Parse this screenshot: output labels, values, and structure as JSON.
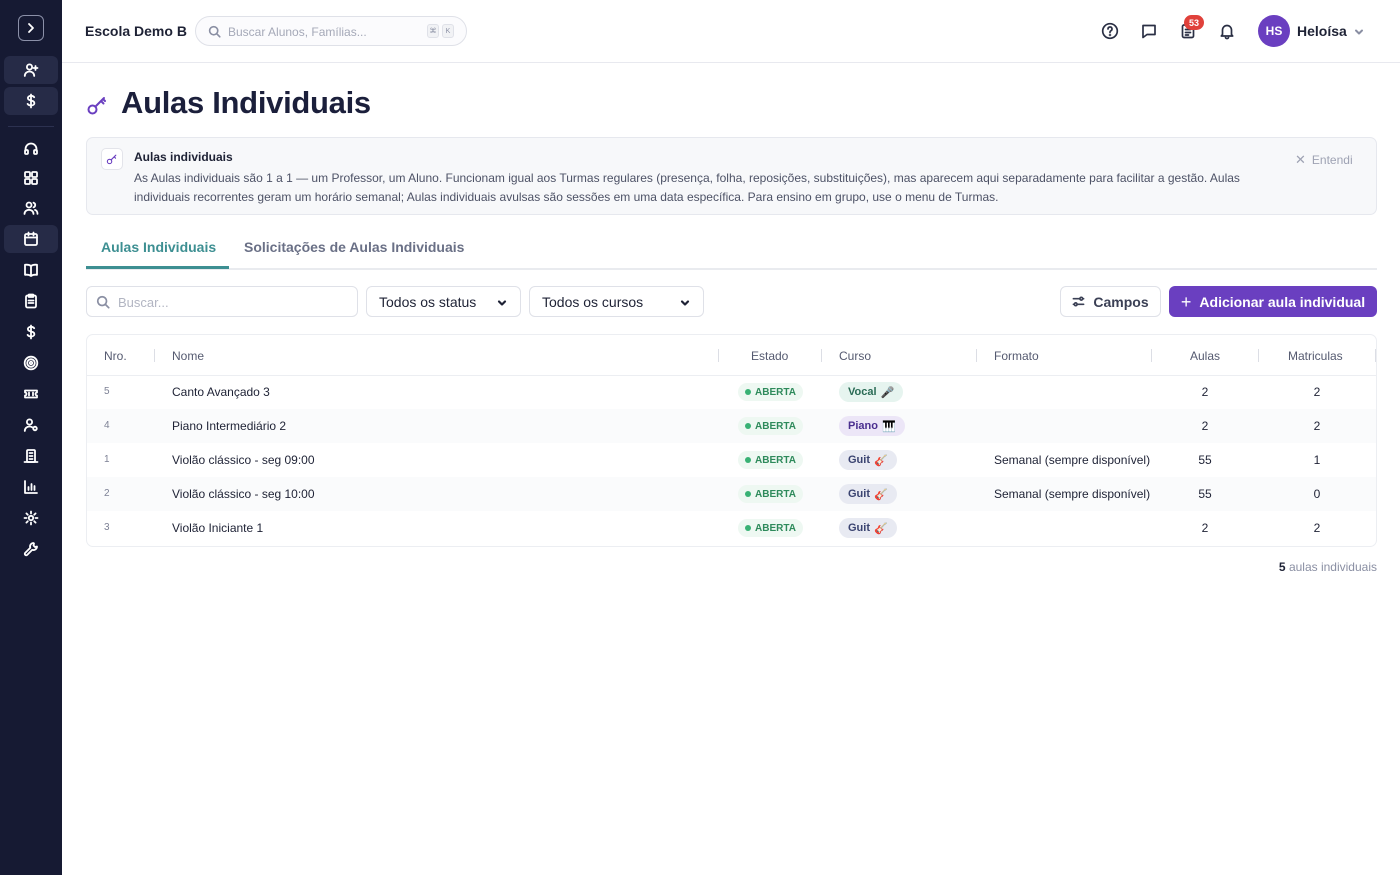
{
  "header": {
    "school_name": "Escola Demo B",
    "search_placeholder": "Buscar Alunos, Famílias...",
    "shortcut_keys": [
      "⌘",
      "K"
    ],
    "notification_count": "53",
    "user_initials": "HS",
    "user_name": "Heloísa"
  },
  "page": {
    "title": "Aulas Individuais"
  },
  "banner": {
    "title": "Aulas individuais",
    "text": "As Aulas individuais são 1 a 1 — um Professor, um Aluno. Funcionam igual aos Turmas regulares (presença, folha, reposições, substituições), mas aparecem aqui separadamente para facilitar a gestão. Aulas individuais recorrentes geram um horário semanal; Aulas individuais avulsas são sessões em uma data específica. Para ensino em grupo, use o menu de Turmas.",
    "dismiss_label": "Entendi"
  },
  "tabs": [
    {
      "label": "Aulas Individuais",
      "active": true
    },
    {
      "label": "Solicitações de Aulas Individuais",
      "active": false
    }
  ],
  "filters": {
    "search_placeholder": "Buscar...",
    "status_select": "Todos os status",
    "course_select": "Todos os cursos",
    "fields_button": "Campos",
    "add_button": "Adicionar aula individual"
  },
  "table": {
    "columns": [
      "Nro.",
      "Nome",
      "Estado",
      "Curso",
      "Formato",
      "Aulas",
      "Matriculas"
    ],
    "rows": [
      {
        "nro": "5",
        "nome": "Canto Avançado 3",
        "estado": "ABERTA",
        "curso": "Vocal",
        "curso_icon": "🎤",
        "formato": "",
        "aulas": "2",
        "matriculas": "2"
      },
      {
        "nro": "4",
        "nome": "Piano Intermediário 2",
        "estado": "ABERTA",
        "curso": "Piano",
        "curso_icon": "🎹",
        "formato": "",
        "aulas": "2",
        "matriculas": "2"
      },
      {
        "nro": "1",
        "nome": "Violão clássico - seg 09:00",
        "estado": "ABERTA",
        "curso": "Guit",
        "curso_icon": "🎸",
        "formato": "Semanal (sempre disponível)",
        "aulas": "55",
        "matriculas": "1"
      },
      {
        "nro": "2",
        "nome": "Violão clássico - seg 10:00",
        "estado": "ABERTA",
        "curso": "Guit",
        "curso_icon": "🎸",
        "formato": "Semanal (sempre disponível)",
        "aulas": "55",
        "matriculas": "0"
      },
      {
        "nro": "3",
        "nome": "Violão Iniciante 1",
        "estado": "ABERTA",
        "curso": "Guit",
        "curso_icon": "🎸",
        "formato": "",
        "aulas": "2",
        "matriculas": "2"
      }
    ]
  },
  "footer": {
    "count": "5",
    "count_label": "aulas individuais"
  },
  "colors": {
    "sidebar_bg": "#161a33",
    "accent_purple": "#6a3fc0",
    "tab_active_teal": "#3d8f92",
    "status_green": "#2e8a5b",
    "badge_red": "#e0413b"
  },
  "sidebar_icons": [
    "chevron-right-icon",
    "user-plus-icon",
    "dollar-icon",
    "headset-icon",
    "dashboard-icon",
    "users-icon",
    "calendar-icon",
    "book-icon",
    "clipboard-icon",
    "dollar-icon",
    "target-icon",
    "ticket-icon",
    "user-settings-icon",
    "building-icon",
    "bar-chart-icon",
    "gear-icon",
    "wrench-icon"
  ]
}
